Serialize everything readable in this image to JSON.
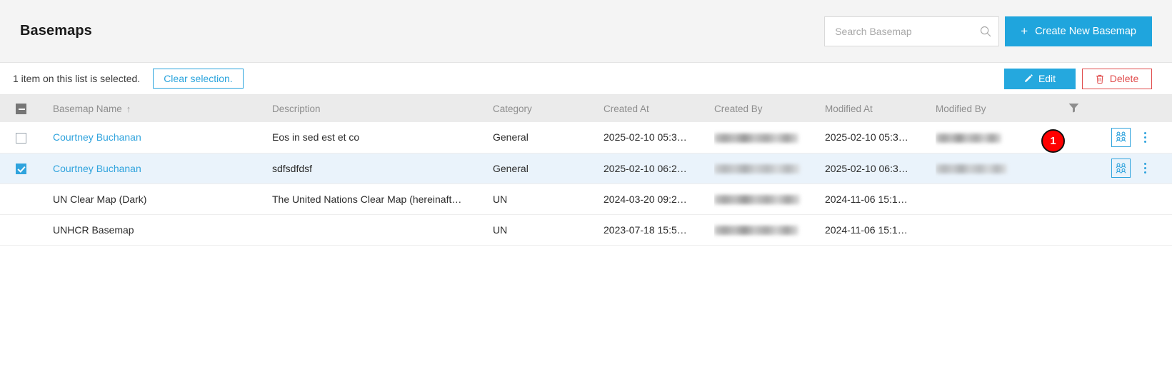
{
  "header": {
    "title": "Basemaps",
    "search": {
      "placeholder": "Search Basemap",
      "value": "",
      "icon": "search-icon"
    },
    "create_button": {
      "label": "Create New Basemap",
      "icon": "plus-icon",
      "color": "#1fa5dd"
    }
  },
  "selection_bar": {
    "status_text": "1 item on this list is selected.",
    "clear_label": "Clear selection.",
    "edit_label": "Edit",
    "edit_icon": "pencil-icon",
    "delete_label": "Delete",
    "delete_icon": "trash-icon",
    "edit_color": "#25a8de",
    "delete_color": "#e04b4b"
  },
  "table": {
    "columns": [
      {
        "key": "checkbox",
        "label": ""
      },
      {
        "key": "name",
        "label": "Basemap Name",
        "sort": "↑"
      },
      {
        "key": "description",
        "label": "Description"
      },
      {
        "key": "category",
        "label": "Category"
      },
      {
        "key": "created_at",
        "label": "Created At"
      },
      {
        "key": "created_by",
        "label": "Created By"
      },
      {
        "key": "modified_at",
        "label": "Modified At"
      },
      {
        "key": "modified_by",
        "label": "Modified By"
      },
      {
        "key": "filter",
        "label": "",
        "icon": "filter-icon"
      }
    ],
    "header_checkbox_state": "indeterminate",
    "rows": [
      {
        "selected": false,
        "checkbox": "unchecked",
        "name": "Courtney Buchanan",
        "name_is_link": true,
        "description": "Eos in sed est et co",
        "category": "General",
        "created_at": "2025-02-10 05:3…",
        "created_by": "",
        "created_by_redacted": true,
        "modified_at": "2025-02-10 05:3…",
        "modified_by": "",
        "modified_by_redacted": true,
        "has_actions": true
      },
      {
        "selected": true,
        "checkbox": "checked",
        "name": "Courtney Buchanan",
        "name_is_link": true,
        "description": "sdfsdfdsf",
        "category": "General",
        "created_at": "2025-02-10 06:2…",
        "created_by": "",
        "created_by_redacted": true,
        "modified_at": "2025-02-10 06:3…",
        "modified_by": "",
        "modified_by_redacted": true,
        "has_actions": true
      },
      {
        "selected": false,
        "checkbox": "none",
        "name": "UN Clear Map (Dark)",
        "name_is_link": false,
        "description": "The United Nations Clear Map (hereinaft…",
        "category": "UN",
        "created_at": "2024-03-20 09:2…",
        "created_by": "",
        "created_by_redacted": true,
        "modified_at": "2024-11-06 15:1…",
        "modified_by": "",
        "modified_by_redacted": false,
        "has_actions": false
      },
      {
        "selected": false,
        "checkbox": "none",
        "name": "UNHCR Basemap",
        "name_is_link": false,
        "description": "",
        "category": "UN",
        "created_at": "2023-07-18 15:5…",
        "created_by": "",
        "created_by_redacted": true,
        "modified_at": "2024-11-06 15:1…",
        "modified_by": "",
        "modified_by_redacted": false,
        "has_actions": false
      }
    ],
    "row_actions": {
      "share_icon": "user-group-icon",
      "menu_icon": "kebab-menu-icon"
    }
  },
  "annotation": {
    "step_badge": "1",
    "badge_color": "#ff0000"
  }
}
